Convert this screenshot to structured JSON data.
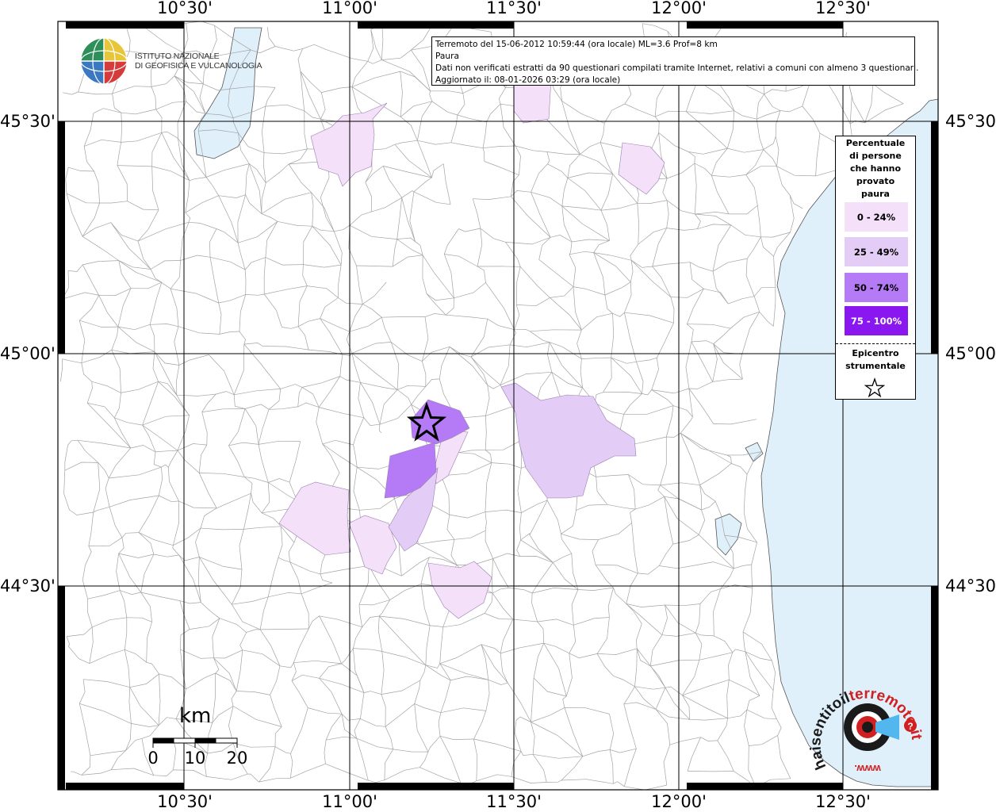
{
  "map": {
    "lon_labels": [
      "10°30'",
      "11°00'",
      "11°30'",
      "12°00'",
      "12°30'"
    ],
    "lat_labels": [
      "45°30'",
      "45°00'",
      "44°30'"
    ],
    "colors": {
      "land": "#ffffff",
      "sea": "#dff0fb",
      "boundary": "#9a9a9a",
      "class_0_24": "#f4e0f9",
      "class_25_49": "#e3ccf5",
      "class_50_74": "#b57af5",
      "class_75_100": "#8a16f0"
    }
  },
  "info": {
    "line1": "Terremoto del 15-06-2012 10:59:44 (ora locale) ML=3.6 Prof=8 km",
    "line2": "Paura",
    "line3": "Dati non verificati estratti da 90 questionari compilati tramite Internet, relativi a comuni con almeno 3 questionari.",
    "line4": "Aggiornato il: 08-01-2026 03:29 (ora locale)"
  },
  "legend": {
    "title_lines": [
      "Percentuale",
      "di persone",
      "che hanno",
      "provato",
      "paura"
    ],
    "classes": [
      {
        "label": "0 - 24%",
        "color": "#f4e0f9",
        "text_color": "#000000"
      },
      {
        "label": "25 - 49%",
        "color": "#e3ccf5",
        "text_color": "#000000"
      },
      {
        "label": "50 - 74%",
        "color": "#b57af5",
        "text_color": "#000000"
      },
      {
        "label": "75 - 100%",
        "color": "#8a16f0",
        "text_color": "#ffffff"
      }
    ],
    "epicenter_lines": [
      "Epicentro",
      "strumentale"
    ],
    "epicenter_icon": "star-outline-icon"
  },
  "logo": {
    "line1": "ISTITUTO NAZIONALE",
    "line2": "DI GEOFISICA E VULCANOLOGIA",
    "icon": "globe-icon"
  },
  "scale": {
    "unit": "km",
    "labels": [
      "0",
      "10",
      "20"
    ]
  },
  "brand": {
    "arc_text_dark": "haisentitoil",
    "arc_text_red": "terremoto.it",
    "bottom_text": "www.",
    "badge": "?"
  }
}
